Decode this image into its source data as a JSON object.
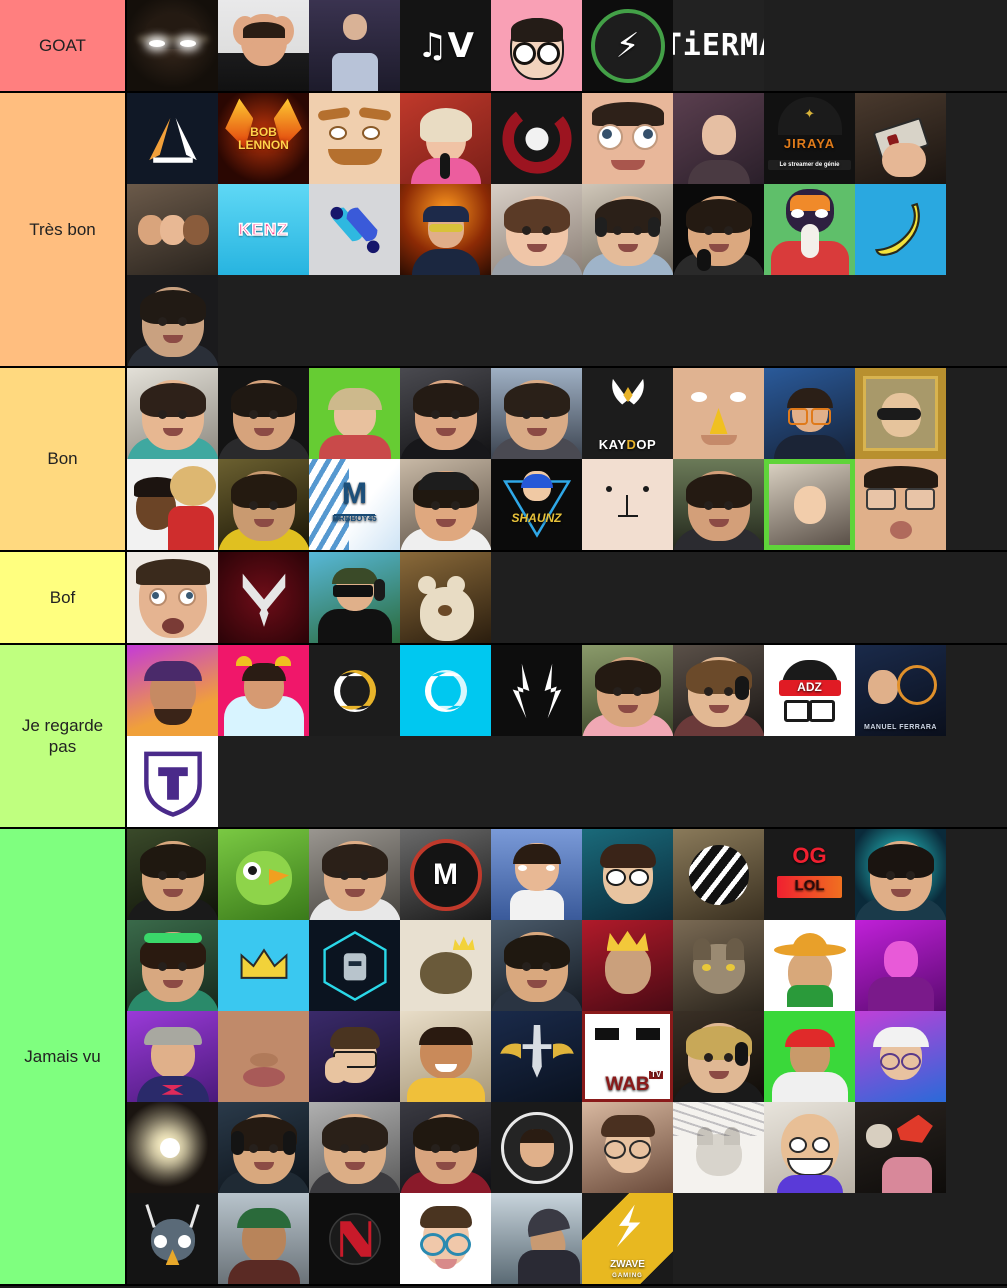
{
  "app": {
    "name": "TierMaker",
    "logo_text": "TiERMAKER",
    "background_color": "#1a1a1a"
  },
  "tiers": [
    {
      "id": "goat",
      "label": "GOAT",
      "color": "#ff7f7f",
      "items": [
        {
          "name": "dark-avatar-glowing-eyes",
          "label": ""
        },
        {
          "name": "man-hands-on-head",
          "label": ""
        },
        {
          "name": "concert-crowd-photo",
          "label": ""
        },
        {
          "name": "mv-logo",
          "label": "MV"
        },
        {
          "name": "pink-cartoon-glasses-avatar",
          "label": ""
        },
        {
          "name": "green-circle-z-logo",
          "label": "Z"
        },
        {
          "name": "tiermaker-logo",
          "label": "TiERMAKER"
        }
      ]
    },
    {
      "id": "tres-bon",
      "label": "Très bon",
      "color": "#ffbe7f",
      "items": [
        {
          "name": "orange-white-triangle-logo",
          "label": ""
        },
        {
          "name": "bob-lennon-fire-logo",
          "label": "BOB LENNON"
        },
        {
          "name": "mustache-cartoon-face",
          "label": ""
        },
        {
          "name": "woman-singing-microphone",
          "label": ""
        },
        {
          "name": "red-swirl-logo",
          "label": ""
        },
        {
          "name": "wide-eyed-man-closeup",
          "label": ""
        },
        {
          "name": "woman-neon-background",
          "label": ""
        },
        {
          "name": "jiraya-logo",
          "label": "JIRAYA"
        },
        {
          "name": "hand-holding-nes-controller",
          "label": ""
        },
        {
          "name": "group-selfie-three-people",
          "label": ""
        },
        {
          "name": "kenz-logo",
          "label": "KENZ"
        },
        {
          "name": "blue-leaf-gradient-logo",
          "label": ""
        },
        {
          "name": "man-cap-explosion-background",
          "label": ""
        },
        {
          "name": "woman-brown-hair-portrait",
          "label": ""
        },
        {
          "name": "young-streamer-headset",
          "label": ""
        },
        {
          "name": "bearded-man-laughing-mic",
          "label": ""
        },
        {
          "name": "cat-avatar-orange-hair",
          "label": ""
        },
        {
          "name": "banana-emoji",
          "label": ""
        },
        {
          "name": "man-dark-room-portrait",
          "label": ""
        }
      ]
    },
    {
      "id": "bon",
      "label": "Bon",
      "color": "#ffd97f",
      "items": [
        {
          "name": "smiling-man-teal-shirt",
          "label": ""
        },
        {
          "name": "man-hand-on-face",
          "label": ""
        },
        {
          "name": "person-green-background-dog",
          "label": ""
        },
        {
          "name": "man-dark-jacket-outdoors",
          "label": ""
        },
        {
          "name": "man-city-rooftop",
          "label": ""
        },
        {
          "name": "kaydop-vitality-logo",
          "label": "KAYDOP"
        },
        {
          "name": "man-yellow-beak-face",
          "label": ""
        },
        {
          "name": "streamer-orange-glasses",
          "label": ""
        },
        {
          "name": "gold-framed-sunglasses-portrait",
          "label": ""
        },
        {
          "name": "one-piece-straw-hat-avatar",
          "label": ""
        },
        {
          "name": "man-yellow-jersey",
          "label": ""
        },
        {
          "name": "mrbboy45-logo",
          "label": "MRBBOY45"
        },
        {
          "name": "man-backwards-cap",
          "label": ""
        },
        {
          "name": "shaunz-logo",
          "label": "SHAUNZ"
        },
        {
          "name": "minimal-line-face-drawing",
          "label": ""
        },
        {
          "name": "man-stadium-background",
          "label": ""
        },
        {
          "name": "blonde-woman-green-border",
          "label": ""
        },
        {
          "name": "man-pursed-lips-glasses",
          "label": ""
        }
      ]
    },
    {
      "id": "bof",
      "label": "Bof",
      "color": "#ffff7f",
      "items": [
        {
          "name": "surprised-man-closeup",
          "label": ""
        },
        {
          "name": "red-chevron-emblem",
          "label": ""
        },
        {
          "name": "streamer-sunglasses-headset",
          "label": ""
        },
        {
          "name": "teddy-bear-with-man",
          "label": ""
        }
      ]
    },
    {
      "id": "je-regarde-pas",
      "label": "Je regarde pas",
      "color": "#bfff7f",
      "items": [
        {
          "name": "man-purple-cap-glitch",
          "label": ""
        },
        {
          "name": "streamer-devil-horns-pink",
          "label": ""
        },
        {
          "name": "solary-dark-logo",
          "label": ""
        },
        {
          "name": "solary-cyan-logo",
          "label": ""
        },
        {
          "name": "white-fangs-logo",
          "label": ""
        },
        {
          "name": "man-pink-shirt-outdoors",
          "label": ""
        },
        {
          "name": "man-headset-long-hair",
          "label": ""
        },
        {
          "name": "adz-logo",
          "label": "ADZ"
        },
        {
          "name": "manuel-ferrara-logo",
          "label": "MANUEL FERRARA"
        },
        {
          "name": "purple-t-shield-logo",
          "label": ""
        }
      ]
    },
    {
      "id": "jamais-vu",
      "label": "Jamais vu",
      "color": "#7fff7f",
      "items": [
        {
          "name": "young-man-black-jersey",
          "label": ""
        },
        {
          "name": "green-parrot-cartoon",
          "label": ""
        },
        {
          "name": "man-white-hoodie",
          "label": ""
        },
        {
          "name": "tm-m-circle-logo",
          "label": "M"
        },
        {
          "name": "cartoon-man-white-tank",
          "label": ""
        },
        {
          "name": "cartoon-boy-angry-eyes",
          "label": ""
        },
        {
          "name": "white-circle-stripes-logo",
          "label": ""
        },
        {
          "name": "og-lol-logo",
          "label": "OG LOL"
        },
        {
          "name": "bearded-man-teal-effects",
          "label": ""
        },
        {
          "name": "woman-green-headband",
          "label": ""
        },
        {
          "name": "yellow-crown-cyan-logo",
          "label": ""
        },
        {
          "name": "robot-hexagon-logo",
          "label": ""
        },
        {
          "name": "hedgehog-crown-cartoon",
          "label": ""
        },
        {
          "name": "man-desk-setup",
          "label": ""
        },
        {
          "name": "cartoon-king-red-crown",
          "label": ""
        },
        {
          "name": "wolf-photo",
          "label": ""
        },
        {
          "name": "sombrero-cartoon-avatar",
          "label": ""
        },
        {
          "name": "purple-neon-portrait",
          "label": ""
        },
        {
          "name": "man-flat-cap-bowtie",
          "label": ""
        },
        {
          "name": "face-closeup-lips",
          "label": ""
        },
        {
          "name": "cartoon-facepalm-glasses",
          "label": ""
        },
        {
          "name": "smiling-child-yellow-shirt",
          "label": ""
        },
        {
          "name": "winged-sword-emblem",
          "label": ""
        },
        {
          "name": "wab-tv-logo",
          "label": "WAB TV"
        },
        {
          "name": "esports-player-headset",
          "label": ""
        },
        {
          "name": "man-red-cap-green-screen",
          "label": ""
        },
        {
          "name": "streamer-white-cap-glasses",
          "label": ""
        },
        {
          "name": "person-holding-light",
          "label": ""
        },
        {
          "name": "man-headphones-dark",
          "label": ""
        },
        {
          "name": "man-beard-gray-background",
          "label": ""
        },
        {
          "name": "esports-jersey-player",
          "label": ""
        },
        {
          "name": "bearded-avatar-circle-logo",
          "label": ""
        },
        {
          "name": "woman-glasses-cartoon-overlay",
          "label": ""
        },
        {
          "name": "cat-photo-sketch",
          "label": ""
        },
        {
          "name": "bald-cartoon-grin-avatar",
          "label": ""
        },
        {
          "name": "red-bird-mask-character",
          "label": ""
        },
        {
          "name": "antlered-creature-cartoon",
          "label": ""
        },
        {
          "name": "man-green-cap-outdoors",
          "label": ""
        },
        {
          "name": "red-n-emblem",
          "label": ""
        },
        {
          "name": "cartoon-man-blue-glasses",
          "label": ""
        },
        {
          "name": "person-hoodie-looking-up",
          "label": ""
        },
        {
          "name": "zwave-gaming-logo",
          "label": "ZWAVE GAMING"
        }
      ]
    }
  ]
}
